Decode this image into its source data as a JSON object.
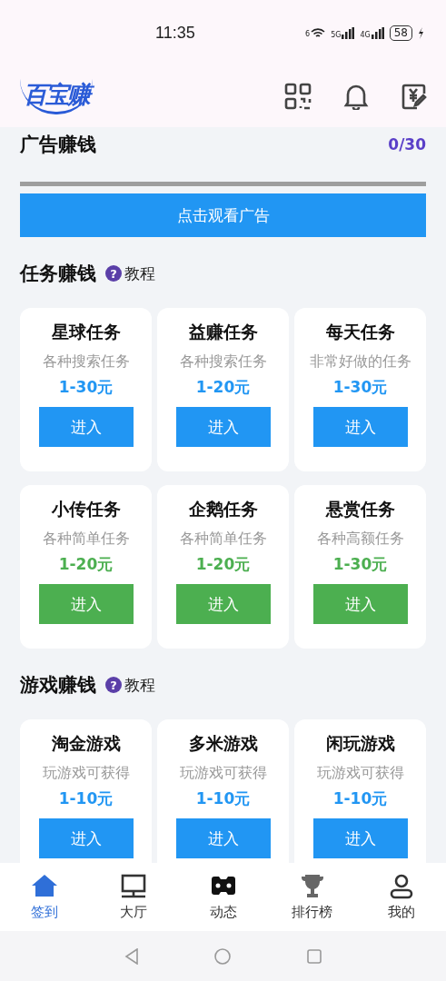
{
  "status_bar": {
    "time": "11:35",
    "wifi_label": "6",
    "signals": [
      {
        "label": "5G"
      },
      {
        "label": "4G"
      }
    ],
    "battery": "58"
  },
  "header": {
    "logo": "百宝赚"
  },
  "ad_section": {
    "title": "广告赚钱",
    "count": "0/30",
    "level": 0,
    "button": "点击观看广告"
  },
  "sections": [
    {
      "title": "任务赚钱",
      "help": "?",
      "help_label": "教程",
      "cards": [
        {
          "name": "星球任务",
          "desc": "各种搜索任务",
          "price": "1-30元",
          "button": "进入",
          "color": "#2196f3"
        },
        {
          "name": "益赚任务",
          "desc": "各种搜索任务",
          "price": "1-20元",
          "button": "进入",
          "color": "#2196f3"
        },
        {
          "name": "每天任务",
          "desc": "非常好做的任务",
          "price": "1-30元",
          "button": "进入",
          "color": "#2196f3"
        },
        {
          "name": "小传任务",
          "desc": "各种简单任务",
          "price": "1-20元",
          "button": "进入",
          "color": "#4caf50"
        },
        {
          "name": "企鹅任务",
          "desc": "各种简单任务",
          "price": "1-20元",
          "button": "进入",
          "color": "#4caf50"
        },
        {
          "name": "悬赏任务",
          "desc": "各种高额任务",
          "price": "1-30元",
          "button": "进入",
          "color": "#4caf50"
        }
      ]
    },
    {
      "title": "游戏赚钱",
      "help": "?",
      "help_label": "教程",
      "cards": [
        {
          "name": "淘金游戏",
          "desc": "玩游戏可获得",
          "price": "1-10元",
          "button": "进入",
          "color": "#2196f3"
        },
        {
          "name": "多米游戏",
          "desc": "玩游戏可获得",
          "price": "1-10元",
          "button": "进入",
          "color": "#2196f3"
        },
        {
          "name": "闲玩游戏",
          "desc": "玩游戏可获得",
          "price": "1-10元",
          "button": "进入",
          "color": "#2196f3"
        }
      ]
    }
  ],
  "tab_bar": [
    {
      "label": "签到",
      "kind": "home",
      "selected": true
    },
    {
      "label": "大厅",
      "kind": "monitor",
      "selected": false
    },
    {
      "label": "动态",
      "kind": "mask",
      "selected": false
    },
    {
      "label": "排行榜",
      "kind": "trophy",
      "selected": false
    },
    {
      "label": "我的",
      "kind": "person",
      "selected": false
    }
  ]
}
